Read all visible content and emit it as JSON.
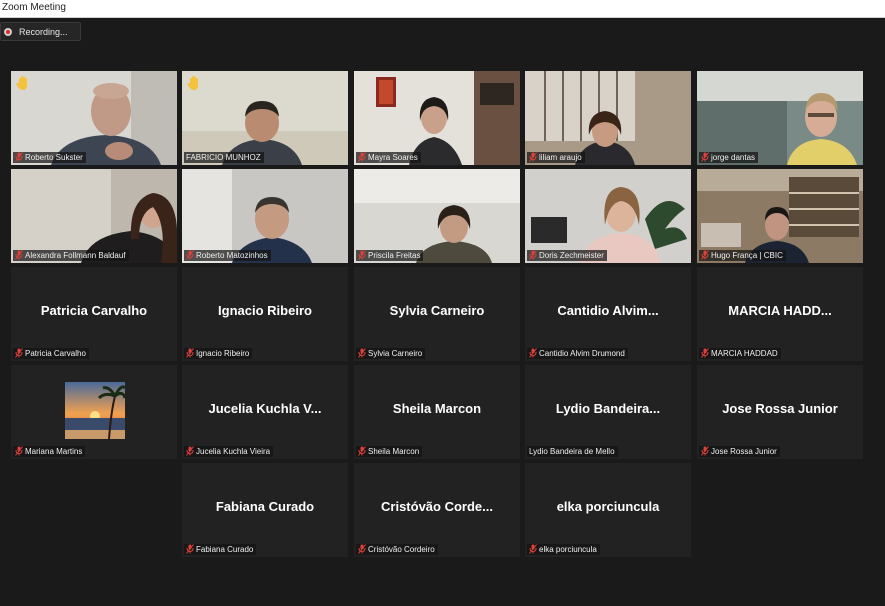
{
  "window": {
    "title": "Zoom Meeting"
  },
  "recording": {
    "label": "Recording..."
  },
  "participants": [
    {
      "id": "p1",
      "name": "Roberto Sukster",
      "hand": true
    },
    {
      "id": "p2",
      "name": "FABRICIO MUNHOZ",
      "hand": true,
      "active": true
    },
    {
      "id": "p3",
      "name": "Mayra Soares"
    },
    {
      "id": "p4",
      "name": "liliam araujo"
    },
    {
      "id": "p5",
      "name": "jorge dantas"
    },
    {
      "id": "p6",
      "name": "Alexandra Follmann Baldauf"
    },
    {
      "id": "p7",
      "name": "Roberto Matozinhos"
    },
    {
      "id": "p8",
      "name": "Priscila Freitas"
    },
    {
      "id": "p9",
      "name": "Doris Zechmeister"
    },
    {
      "id": "p10",
      "name": "Hugo França | CBIC"
    },
    {
      "id": "p11",
      "display": "Patricia Carvalho",
      "name": "Patricia Carvalho"
    },
    {
      "id": "p12",
      "display": "Ignacio Ribeiro",
      "name": "Ignacio Ribeiro"
    },
    {
      "id": "p13",
      "display": "Sylvia Carneiro",
      "name": "Sylvia Carneiro"
    },
    {
      "id": "p14",
      "display": "Cantidio  Alvim...",
      "name": "Cantidio Alvim Drumond"
    },
    {
      "id": "p15",
      "display": "MARCIA  HADD...",
      "name": "MARCIA HADDAD"
    },
    {
      "id": "p16",
      "name": "Mariana Martins"
    },
    {
      "id": "p17",
      "display": "Jucelia  Kuchla  V...",
      "name": "Jucelia Kuchla Vieira"
    },
    {
      "id": "p18",
      "display": "Sheila Marcon",
      "name": "Sheila Marcon"
    },
    {
      "id": "p19",
      "display": "Lydio  Bandeira...",
      "name": "Lydio Bandeira de Mello",
      "unmuted": true
    },
    {
      "id": "p20",
      "display": "Jose Rossa Junior",
      "name": "Jose Rossa Junior"
    },
    {
      "id": "p21",
      "display": "Fabiana Curado",
      "name": "Fabiana Curado"
    },
    {
      "id": "p22",
      "display": "Cristóvão  Corde...",
      "name": "Cristóvão Cordeiro"
    },
    {
      "id": "p23",
      "display": "elka porciuncula",
      "name": "elka porciuncula"
    }
  ],
  "colors": {
    "active_border": "#b8d94a",
    "muted_icon": "#e0403a",
    "hand": "#f5c33b"
  },
  "icons": {
    "muted": "mic-muted-icon",
    "hand": "raised-hand-icon",
    "record": "record-icon"
  }
}
